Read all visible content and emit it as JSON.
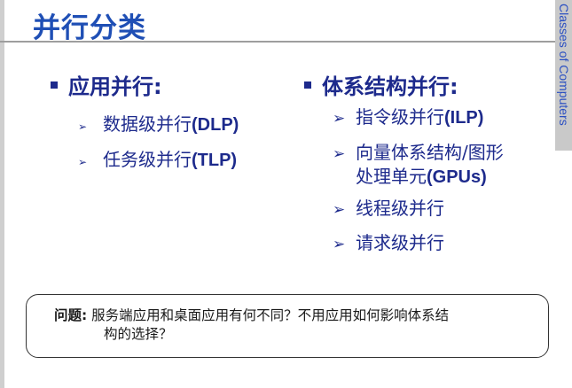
{
  "slide": {
    "title": "并行分类",
    "side_label": "Classes of Computers"
  },
  "left_section": {
    "heading": "应用并行:",
    "items": [
      {
        "text": "数据级并行",
        "bold": "(DLP)"
      },
      {
        "text": "任务级并行",
        "bold": "(TLP)"
      }
    ]
  },
  "right_section": {
    "heading": "体系结构并行:",
    "items": [
      {
        "text": "指令级并行",
        "bold": "(ILP)"
      },
      {
        "line1": "向量体系结构/图形",
        "line2": "处理单元",
        "bold": "(GPUs)"
      },
      {
        "text": "线程级并行"
      },
      {
        "text": "请求级并行"
      }
    ]
  },
  "question": {
    "label": "问题:",
    "line1": "服务端应用和桌面应用有何不同？不用应用如何影响体系结",
    "line2": "构的选择？"
  },
  "colors": {
    "title": "#1f4fb5",
    "body_text": "#1d2a8c",
    "side_tab": "#c9c9c9"
  }
}
